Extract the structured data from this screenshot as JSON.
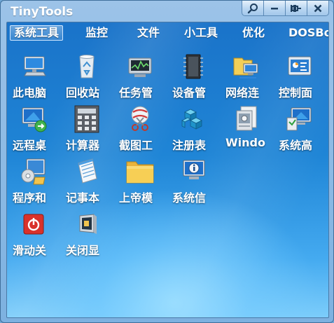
{
  "window": {
    "title": "TinyTools"
  },
  "title_buttons": {
    "search": "search-icon",
    "minimize": "minimize-icon",
    "pin": "pin-icon",
    "close": "close-icon"
  },
  "tabs": [
    {
      "label": "系统工具",
      "active": true
    },
    {
      "label": "监控"
    },
    {
      "label": "文件"
    },
    {
      "label": "小工具"
    },
    {
      "label": "优化"
    },
    {
      "label": "DOSBo"
    }
  ],
  "items": [
    {
      "label": "此电脑",
      "icon": "computer-icon"
    },
    {
      "label": "回收站",
      "icon": "recycle-bin-icon"
    },
    {
      "label": "任务管",
      "icon": "task-manager-icon"
    },
    {
      "label": "设备管",
      "icon": "device-manager-icon"
    },
    {
      "label": "网络连",
      "icon": "network-connections-icon"
    },
    {
      "label": "控制面",
      "icon": "control-panel-icon"
    },
    {
      "label": "远程桌",
      "icon": "remote-desktop-icon"
    },
    {
      "label": "计算器",
      "icon": "calculator-icon"
    },
    {
      "label": "截图工",
      "icon": "snipping-tool-icon"
    },
    {
      "label": "注册表",
      "icon": "registry-icon"
    },
    {
      "label": "Windo",
      "icon": "windows-tools-icon"
    },
    {
      "label": "系统高",
      "icon": "system-advanced-icon"
    },
    {
      "label": "程序和",
      "icon": "programs-features-icon"
    },
    {
      "label": "记事本",
      "icon": "notepad-icon"
    },
    {
      "label": "上帝模",
      "icon": "god-mode-folder-icon"
    },
    {
      "label": "系统信",
      "icon": "system-info-icon"
    },
    {
      "label": "滑动关",
      "icon": "slide-shutdown-icon"
    },
    {
      "label": "关闭显",
      "icon": "display-off-icon"
    }
  ],
  "colors": {
    "accent": "#1f85d6",
    "title_bar": "#8fbbe5",
    "shutdown": "#d9322b"
  }
}
